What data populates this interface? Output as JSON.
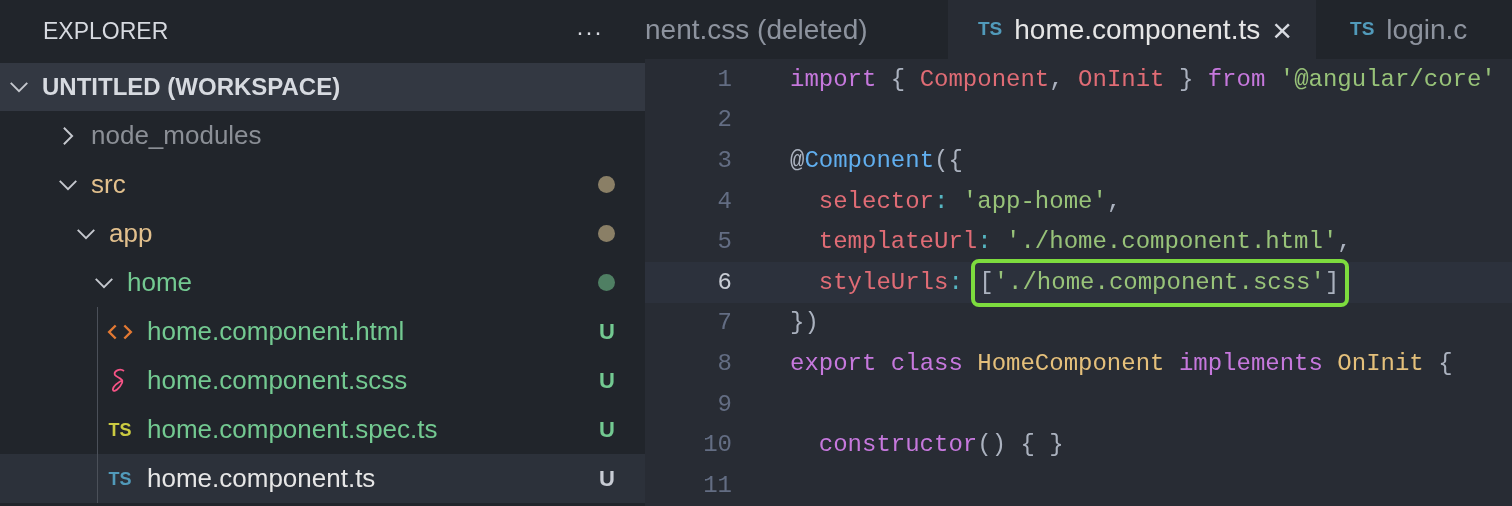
{
  "sidebar": {
    "title": "EXPLORER",
    "menu": "···",
    "workspace": {
      "label": "UNTITLED (WORKSPACE)",
      "expanded": true,
      "children": [
        {
          "label": "node_modules",
          "kind": "folder",
          "expanded": false,
          "color": "#8b8f96",
          "selected": false
        },
        {
          "label": "src",
          "kind": "folder",
          "expanded": true,
          "color": "#e2c08d",
          "dot": {
            "color": "#8a7f66"
          },
          "selected": false,
          "children": [
            {
              "label": "app",
              "kind": "folder",
              "expanded": true,
              "color": "#e2c08d",
              "dot": {
                "color": "#8a7f66"
              },
              "selected": false,
              "children": [
                {
                  "label": "home",
                  "kind": "folder",
                  "expanded": true,
                  "color": "#73c991",
                  "dot": {
                    "color": "#4f7f63"
                  },
                  "selected": false,
                  "children": [
                    {
                      "label": "home.component.html",
                      "kind": "html",
                      "color": "#73c991",
                      "badge": "U",
                      "selected": false
                    },
                    {
                      "label": "home.component.scss",
                      "kind": "sass",
                      "color": "#73c991",
                      "badge": "U",
                      "selected": false
                    },
                    {
                      "label": "home.component.spec.ts",
                      "kind": "ts-test",
                      "icon_text": "TS",
                      "color": "#73c991",
                      "badge": "U",
                      "selected": false
                    },
                    {
                      "label": "home.component.ts",
                      "kind": "ts",
                      "icon_text": "TS",
                      "color": "#e6e6e6",
                      "badge": "U",
                      "selected": true
                    }
                  ]
                }
              ]
            }
          ]
        }
      ]
    }
  },
  "tabs": [
    {
      "label": "nent.css (deleted)",
      "selected": false
    },
    {
      "label": "home.component.ts",
      "icon_text": "TS",
      "close": "×",
      "selected": true
    },
    {
      "label": "login.c",
      "icon_text": "TS",
      "selected": false
    }
  ],
  "editor": {
    "lines": [
      {
        "number": "1",
        "current": false,
        "tokens": [
          {
            "text": "import",
            "kind": "keyword"
          },
          {
            "text": " { ",
            "kind": "punct"
          },
          {
            "text": "Component",
            "kind": "variable"
          },
          {
            "text": ", ",
            "kind": "punct"
          },
          {
            "text": "OnInit",
            "kind": "variable"
          },
          {
            "text": " } ",
            "kind": "punct"
          },
          {
            "text": "from",
            "kind": "keyword"
          },
          {
            "text": " '@angular/core'",
            "kind": "string"
          }
        ]
      },
      {
        "number": "2",
        "current": false
      },
      {
        "number": "3",
        "current": false,
        "tokens": [
          {
            "text": "@",
            "kind": "punct"
          },
          {
            "text": "Component",
            "kind": "function"
          },
          {
            "text": "({",
            "kind": "punct"
          }
        ]
      },
      {
        "number": "4",
        "current": false,
        "tokens": [
          {
            "text": "  selector",
            "kind": "variable"
          },
          {
            "text": ": ",
            "kind": "operator"
          },
          {
            "text": "'app-home'",
            "kind": "string"
          },
          {
            "text": ",",
            "kind": "punct"
          }
        ]
      },
      {
        "number": "5",
        "current": false,
        "tokens": [
          {
            "text": "  templateUrl",
            "kind": "variable"
          },
          {
            "text": ": ",
            "kind": "operator"
          },
          {
            "text": "'./home.component.html'",
            "kind": "string"
          },
          {
            "text": ",",
            "kind": "punct"
          }
        ]
      },
      {
        "number": "6",
        "current": true,
        "tokens": [
          {
            "text": "  styleUrls",
            "kind": "variable"
          },
          {
            "text": ": ",
            "kind": "operator"
          },
          {
            "text": "[",
            "kind": "punct",
            "boxed": true
          },
          {
            "text": "'./home.component.scss'",
            "kind": "string",
            "boxed": true
          },
          {
            "text": "]",
            "kind": "punct",
            "boxed": true
          }
        ]
      },
      {
        "number": "7",
        "current": false,
        "tokens": [
          {
            "text": "})",
            "kind": "punct"
          }
        ]
      },
      {
        "number": "8",
        "current": false,
        "tokens": [
          {
            "text": "export",
            "kind": "keyword"
          },
          {
            "text": " class",
            "kind": "keyword"
          },
          {
            "text": " HomeComponent",
            "kind": "type"
          },
          {
            "text": " implements",
            "kind": "keyword"
          },
          {
            "text": " OnInit",
            "kind": "type"
          },
          {
            "text": " {",
            "kind": "punct"
          }
        ]
      },
      {
        "number": "9",
        "current": false
      },
      {
        "number": "10",
        "current": false,
        "tokens": [
          {
            "text": "  constructor",
            "kind": "keyword"
          },
          {
            "text": "() { }",
            "kind": "punct"
          }
        ]
      },
      {
        "number": "11",
        "current": false
      }
    ]
  }
}
